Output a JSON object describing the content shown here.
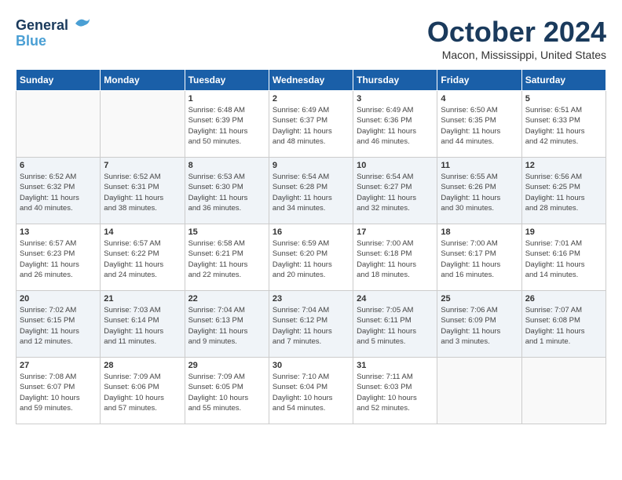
{
  "header": {
    "logo_line1": "General",
    "logo_line2": "Blue",
    "month": "October 2024",
    "location": "Macon, Mississippi, United States"
  },
  "weekdays": [
    "Sunday",
    "Monday",
    "Tuesday",
    "Wednesday",
    "Thursday",
    "Friday",
    "Saturday"
  ],
  "weeks": [
    [
      {
        "day": "",
        "detail": ""
      },
      {
        "day": "",
        "detail": ""
      },
      {
        "day": "1",
        "detail": "Sunrise: 6:48 AM\nSunset: 6:39 PM\nDaylight: 11 hours\nand 50 minutes."
      },
      {
        "day": "2",
        "detail": "Sunrise: 6:49 AM\nSunset: 6:37 PM\nDaylight: 11 hours\nand 48 minutes."
      },
      {
        "day": "3",
        "detail": "Sunrise: 6:49 AM\nSunset: 6:36 PM\nDaylight: 11 hours\nand 46 minutes."
      },
      {
        "day": "4",
        "detail": "Sunrise: 6:50 AM\nSunset: 6:35 PM\nDaylight: 11 hours\nand 44 minutes."
      },
      {
        "day": "5",
        "detail": "Sunrise: 6:51 AM\nSunset: 6:33 PM\nDaylight: 11 hours\nand 42 minutes."
      }
    ],
    [
      {
        "day": "6",
        "detail": "Sunrise: 6:52 AM\nSunset: 6:32 PM\nDaylight: 11 hours\nand 40 minutes."
      },
      {
        "day": "7",
        "detail": "Sunrise: 6:52 AM\nSunset: 6:31 PM\nDaylight: 11 hours\nand 38 minutes."
      },
      {
        "day": "8",
        "detail": "Sunrise: 6:53 AM\nSunset: 6:30 PM\nDaylight: 11 hours\nand 36 minutes."
      },
      {
        "day": "9",
        "detail": "Sunrise: 6:54 AM\nSunset: 6:28 PM\nDaylight: 11 hours\nand 34 minutes."
      },
      {
        "day": "10",
        "detail": "Sunrise: 6:54 AM\nSunset: 6:27 PM\nDaylight: 11 hours\nand 32 minutes."
      },
      {
        "day": "11",
        "detail": "Sunrise: 6:55 AM\nSunset: 6:26 PM\nDaylight: 11 hours\nand 30 minutes."
      },
      {
        "day": "12",
        "detail": "Sunrise: 6:56 AM\nSunset: 6:25 PM\nDaylight: 11 hours\nand 28 minutes."
      }
    ],
    [
      {
        "day": "13",
        "detail": "Sunrise: 6:57 AM\nSunset: 6:23 PM\nDaylight: 11 hours\nand 26 minutes."
      },
      {
        "day": "14",
        "detail": "Sunrise: 6:57 AM\nSunset: 6:22 PM\nDaylight: 11 hours\nand 24 minutes."
      },
      {
        "day": "15",
        "detail": "Sunrise: 6:58 AM\nSunset: 6:21 PM\nDaylight: 11 hours\nand 22 minutes."
      },
      {
        "day": "16",
        "detail": "Sunrise: 6:59 AM\nSunset: 6:20 PM\nDaylight: 11 hours\nand 20 minutes."
      },
      {
        "day": "17",
        "detail": "Sunrise: 7:00 AM\nSunset: 6:18 PM\nDaylight: 11 hours\nand 18 minutes."
      },
      {
        "day": "18",
        "detail": "Sunrise: 7:00 AM\nSunset: 6:17 PM\nDaylight: 11 hours\nand 16 minutes."
      },
      {
        "day": "19",
        "detail": "Sunrise: 7:01 AM\nSunset: 6:16 PM\nDaylight: 11 hours\nand 14 minutes."
      }
    ],
    [
      {
        "day": "20",
        "detail": "Sunrise: 7:02 AM\nSunset: 6:15 PM\nDaylight: 11 hours\nand 12 minutes."
      },
      {
        "day": "21",
        "detail": "Sunrise: 7:03 AM\nSunset: 6:14 PM\nDaylight: 11 hours\nand 11 minutes."
      },
      {
        "day": "22",
        "detail": "Sunrise: 7:04 AM\nSunset: 6:13 PM\nDaylight: 11 hours\nand 9 minutes."
      },
      {
        "day": "23",
        "detail": "Sunrise: 7:04 AM\nSunset: 6:12 PM\nDaylight: 11 hours\nand 7 minutes."
      },
      {
        "day": "24",
        "detail": "Sunrise: 7:05 AM\nSunset: 6:11 PM\nDaylight: 11 hours\nand 5 minutes."
      },
      {
        "day": "25",
        "detail": "Sunrise: 7:06 AM\nSunset: 6:09 PM\nDaylight: 11 hours\nand 3 minutes."
      },
      {
        "day": "26",
        "detail": "Sunrise: 7:07 AM\nSunset: 6:08 PM\nDaylight: 11 hours\nand 1 minute."
      }
    ],
    [
      {
        "day": "27",
        "detail": "Sunrise: 7:08 AM\nSunset: 6:07 PM\nDaylight: 10 hours\nand 59 minutes."
      },
      {
        "day": "28",
        "detail": "Sunrise: 7:09 AM\nSunset: 6:06 PM\nDaylight: 10 hours\nand 57 minutes."
      },
      {
        "day": "29",
        "detail": "Sunrise: 7:09 AM\nSunset: 6:05 PM\nDaylight: 10 hours\nand 55 minutes."
      },
      {
        "day": "30",
        "detail": "Sunrise: 7:10 AM\nSunset: 6:04 PM\nDaylight: 10 hours\nand 54 minutes."
      },
      {
        "day": "31",
        "detail": "Sunrise: 7:11 AM\nSunset: 6:03 PM\nDaylight: 10 hours\nand 52 minutes."
      },
      {
        "day": "",
        "detail": ""
      },
      {
        "day": "",
        "detail": ""
      }
    ]
  ]
}
